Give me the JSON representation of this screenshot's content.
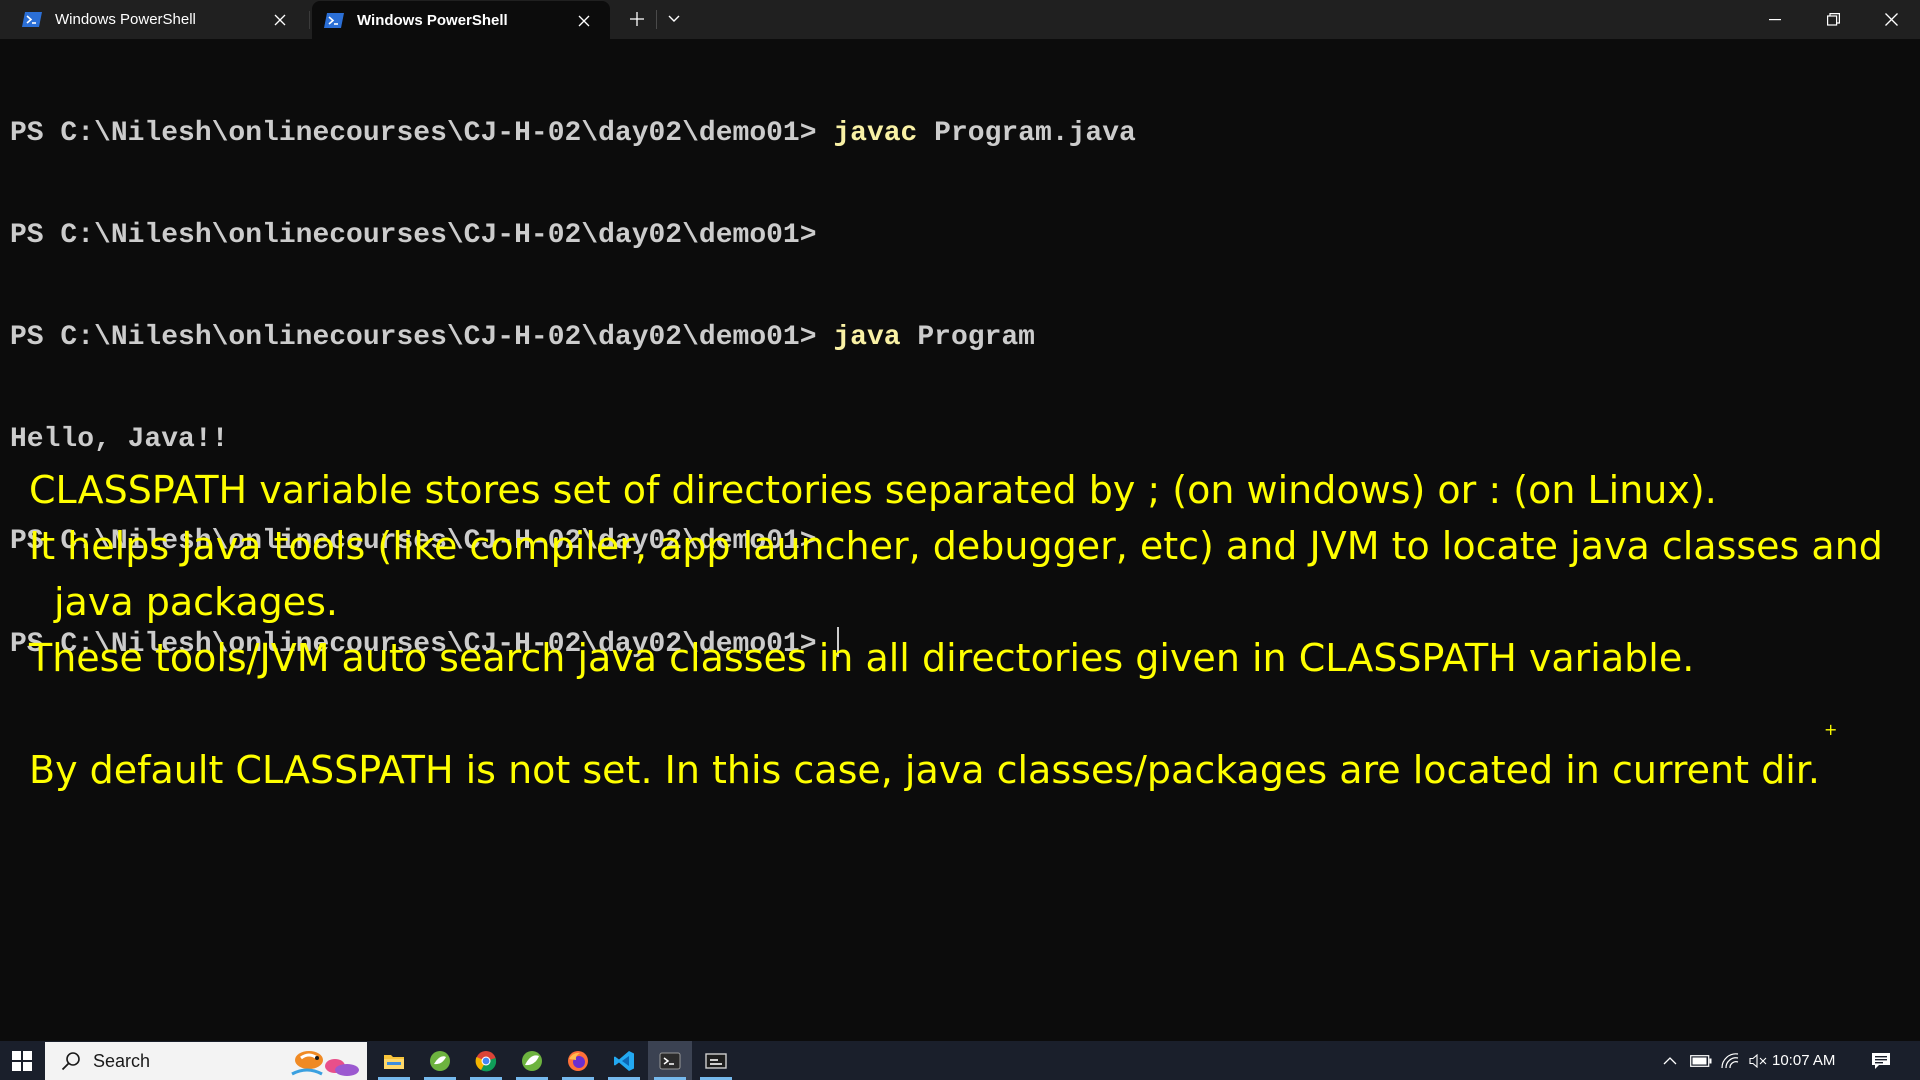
{
  "window": {
    "tabs": [
      {
        "label": "Windows PowerShell",
        "active": false
      },
      {
        "label": "Windows PowerShell",
        "active": true
      }
    ]
  },
  "terminal": {
    "prompt": "PS C:\\Nilesh\\onlinecourses\\CJ-H-02\\day02\\demo01>",
    "lines": [
      {
        "cmd": "javac",
        "args": " Program.java"
      },
      {
        "cmd": "",
        "args": ""
      },
      {
        "cmd": "java",
        "args": " Program"
      }
    ],
    "output": "Hello, Java!!",
    "colors": {
      "text": "#cccccc",
      "command": "#f9f1a5",
      "background": "#0c0c0c"
    }
  },
  "annotation": {
    "color": "#ffff00",
    "lines": [
      "CLASSPATH variable stores set of directories separated by ; (on windows) or : (on Linux).",
      "It helps Java tools (like compiler, app launcher, debugger, etc) and JVM to locate java classes and",
      "java packages.",
      "These tools/JVM auto search java classes in all directories given in CLASSPATH variable.",
      "By default CLASSPATH is not set. In this case, java classes/packages are located in current dir."
    ]
  },
  "taskbar": {
    "search_placeholder": "Search",
    "apps": [
      "file-explorer-icon",
      "spring-tools-icon",
      "chrome-icon",
      "spring-boot-icon",
      "firefox-icon",
      "vscode-icon",
      "terminal-icon",
      "screen-tool-icon"
    ],
    "clock": "10:07 AM"
  }
}
